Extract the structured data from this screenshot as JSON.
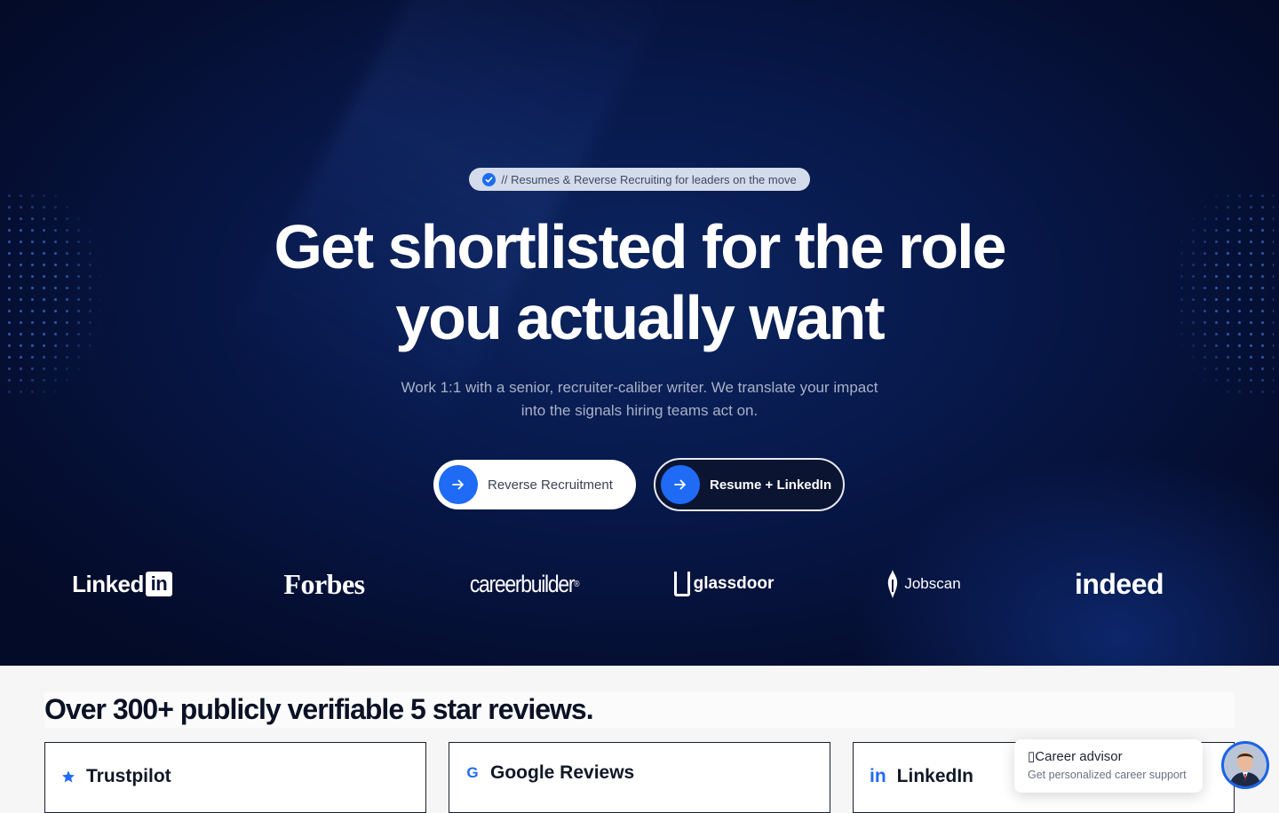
{
  "hero": {
    "badge_text": "// Resumes & Reverse Recruiting for leaders on the move",
    "headline_line1": "Get shortlisted for the role",
    "headline_line2": "you actually want",
    "subtext": "Work 1:1 with a senior, recruiter-caliber writer. We translate your impact into the signals hiring teams act on.",
    "buttons": [
      {
        "label": "Reverse Recruitment",
        "icon": "arrow-right-icon"
      },
      {
        "label": "Resume + LinkedIn",
        "icon": "arrow-right-icon"
      }
    ],
    "accent_color": "#1f6bf5",
    "logos": [
      {
        "name": "LinkedIn",
        "text": "Linked",
        "badge": "in"
      },
      {
        "name": "Forbes",
        "text": "Forbes"
      },
      {
        "name": "careerbuilder",
        "text": "careerbuilder",
        "mark": "®"
      },
      {
        "name": "glassdoor",
        "text": "glassdoor"
      },
      {
        "name": "Jobscan",
        "text": "Jobscan"
      },
      {
        "name": "indeed",
        "text": "indeed"
      }
    ]
  },
  "reviews": {
    "title": "Over 300+ publicly verifiable 5 star reviews.",
    "cards": [
      {
        "label": "Trustpilot",
        "icon": "star-icon"
      },
      {
        "label": "Google Reviews",
        "icon": "google-icon"
      },
      {
        "label": "LinkedIn",
        "icon": "linkedin-icon"
      }
    ]
  },
  "chat_widget": {
    "title": "Career advisor",
    "title_glyph": "▯",
    "subtitle": "Get personalized career support"
  }
}
